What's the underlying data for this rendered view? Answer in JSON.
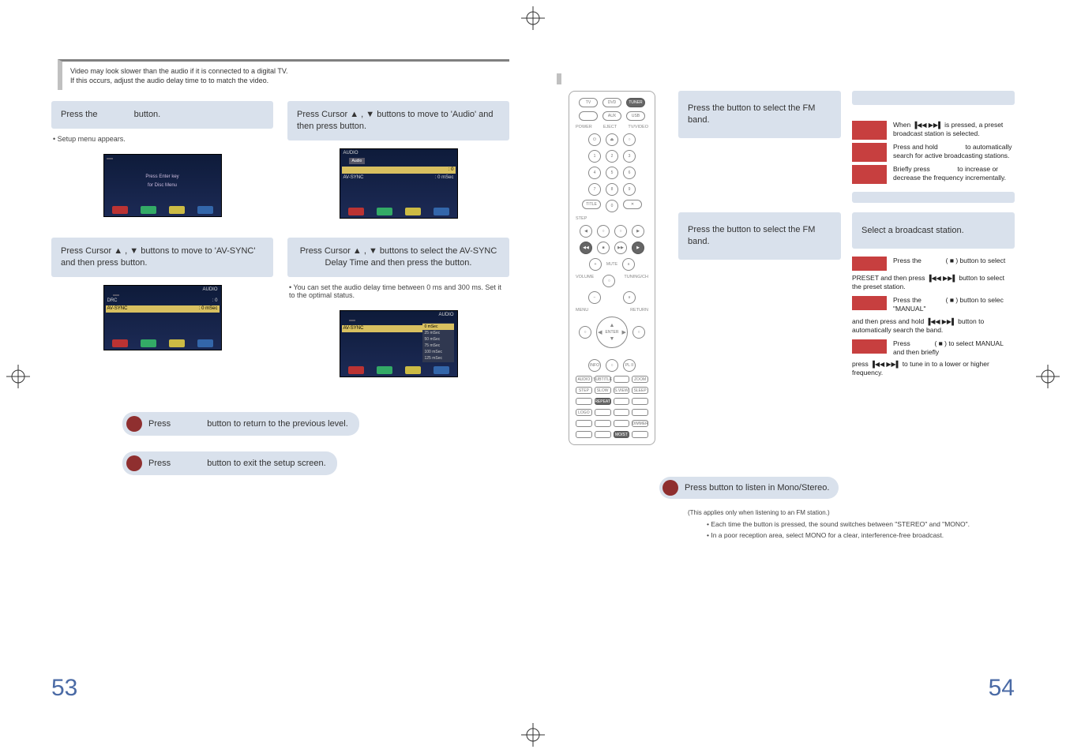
{
  "meta": {
    "pages": [
      53,
      54
    ]
  },
  "left": {
    "intro": [
      "Video may look slower than the audio if it is connected to a digital TV.",
      "If this occurs, adjust the audio delay time to to match the video."
    ],
    "steps": {
      "s1": {
        "pre": "Press the ",
        "post": " button."
      },
      "s1_note": "Setup menu appears.",
      "s2": {
        "line": "Press Cursor ▲ , ▼  buttons to move to 'Audio' and then press           button."
      },
      "s3": {
        "line": "Press Cursor ▲ , ▼  buttons to move to 'AV-SYNC' and then press           button."
      },
      "s4": {
        "line": "Press Cursor ▲ , ▼  buttons to select the AV-SYNC Delay Time  and then press the           button.",
        "note": "You can set the audio delay time between 0 ms and 300 ms. Set it to the optimal status."
      }
    },
    "osd1": {
      "title_l": "",
      "title_r": "",
      "tabs": [
        "",
        "",
        "",
        ""
      ],
      "splash": [
        "Press Enter key",
        "for Disc Menu"
      ]
    },
    "osd2": {
      "menu": [
        {
          "l": "",
          "r": ": 0"
        },
        {
          "l": "AV-SYNC",
          "r": ": 0 mSec"
        }
      ]
    },
    "osd3": {
      "rows": [
        {
          "l": "DRC",
          "r": ": 0"
        },
        {
          "l": "AV-SYNC",
          "r": ": 0 mSec"
        }
      ]
    },
    "osd4": {
      "row_l": "AV-SYNC",
      "opts": [
        "0 mSec",
        "25 mSec",
        "50 mSec",
        "75 mSec",
        "100 mSec",
        "125 mSec"
      ]
    },
    "pill_return": {
      "pre": "Press ",
      "post": " button to return to the previous level."
    },
    "pill_exit": {
      "pre": "Press ",
      "post": " button to exit the setup screen."
    }
  },
  "right": {
    "s1": {
      "line": "Press the             button to select the FM band."
    },
    "s2": {
      "line": "Press the             button to select the FM band."
    },
    "s2_card": "Select a broadcast station.",
    "preset": {
      "r1": "When        is pressed, a preset broadcast station is selected.",
      "r2_a": "Press and hold ",
      "r2_b": " to automatically search for active broadcasting stations.",
      "r3_a": "Briefly press ",
      "r3_b": " to increase or decrease the frequency incrementally."
    },
    "select": {
      "r1": "Press the           ( ■ ) button to select PRESET and then press           button to select the preset station.",
      "r2": "Press the           ( ■ ) button to selec  \"MANUAL\" and then press and hold            button to automatically search the band.",
      "r3": "Press           ( ■ ) to select MANUAL and then briefly press            to tune in to a lower or higher frequency."
    },
    "mono": {
      "head": "Press          button to listen in Mono/Stereo.",
      "sub": "(This applies only when listening to an FM station.)",
      "b1": "Each time the button is pressed, the sound switches between \"STEREO\" and \"MONO\".",
      "b2": "In a poor reception area, select MONO for a clear, interference-free broadcast."
    }
  },
  "remote": {
    "top_row": [
      "TV",
      "DVD",
      "TUNER"
    ],
    "row2": [
      "",
      "AUX",
      "USB"
    ],
    "row3_labels": [
      "POWER",
      "EJECT",
      "TV/VIDEO"
    ],
    "transport": [
      "◀◀",
      "■",
      "▶▶",
      "▶"
    ],
    "volume": "VOLUME",
    "tuning": "TUNING/CH",
    "mute": "MUTE",
    "menu_l": "MENU",
    "menu_r": "RETURN",
    "center": "ENTER",
    "bottom_labels": [
      "INFO",
      "",
      "PL II"
    ],
    "grid_rows": [
      [
        "AUDIO",
        "SUBTITLE",
        "",
        "ZOOM"
      ],
      [
        "STEP",
        "SLOW",
        "S.VIEW",
        "SLEEP"
      ],
      [
        "",
        "REPEAT",
        "",
        ""
      ],
      [
        "LOGO",
        "",
        "",
        ""
      ],
      [
        "",
        "",
        "",
        "DIMMER"
      ],
      [
        "",
        "",
        "MO/ST",
        ""
      ]
    ]
  },
  "icons": {
    "skip": "▐◀◀ ▶▶▌",
    "search": "◀◀ ▶▶",
    "stop": "■"
  }
}
